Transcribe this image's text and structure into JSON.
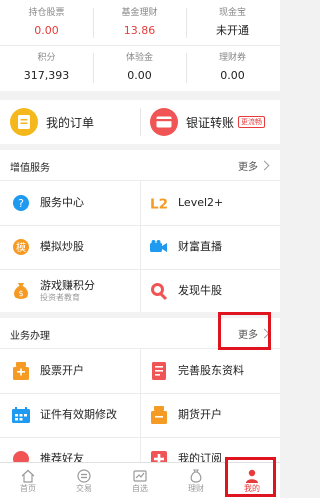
{
  "account": {
    "row1": [
      {
        "label": "持仓股票",
        "value": "0.00",
        "value_color": "#e73b3b"
      },
      {
        "label": "基金理财",
        "value": "13.86",
        "value_color": "#e73b3b"
      },
      {
        "label": "现金宝",
        "value": "未开通",
        "value_color": "#222222"
      }
    ],
    "row2": [
      {
        "label": "积分",
        "value": "317,393"
      },
      {
        "label": "体验金",
        "value": "0.00"
      },
      {
        "label": "理财券",
        "value": "0.00"
      }
    ]
  },
  "quick_actions": {
    "orders_label": "我的订单",
    "transfer_label": "银证转账",
    "transfer_badge": "更流畅"
  },
  "value_services": {
    "title": "增值服务",
    "more_label": "更多",
    "items": [
      {
        "label": "服务中心",
        "icon": "question-icon"
      },
      {
        "label": "Level2+",
        "icon": "l2-icon"
      },
      {
        "label": "模拟炒股",
        "icon": "simulate-icon"
      },
      {
        "label": "财富直播",
        "icon": "live-camera-icon"
      },
      {
        "label": "游戏赚积分",
        "sublabel": "投资者教育",
        "icon": "money-bag-icon"
      },
      {
        "label": "发现牛股",
        "icon": "magnifier-icon"
      }
    ]
  },
  "business": {
    "title": "业务办理",
    "more_label": "更多",
    "items": [
      {
        "label": "股票开户",
        "icon": "open-account-icon"
      },
      {
        "label": "完善股东资料",
        "icon": "document-icon"
      },
      {
        "label": "证件有效期修改",
        "icon": "calendar-icon"
      },
      {
        "label": "期货开户",
        "icon": "futures-icon"
      },
      {
        "label": "推荐好友",
        "icon": "recommend-icon"
      },
      {
        "label": "我的订阅",
        "icon": "subscription-icon"
      }
    ]
  },
  "tabbar": {
    "tabs": [
      {
        "label": "首页",
        "icon": "home-icon"
      },
      {
        "label": "交易",
        "icon": "trade-icon"
      },
      {
        "label": "自选",
        "icon": "watchlist-icon"
      },
      {
        "label": "理财",
        "icon": "wealth-icon"
      },
      {
        "label": "我的",
        "icon": "profile-icon",
        "active": true
      }
    ]
  },
  "colors": {
    "accent_red": "#e73b3b",
    "highlight_red": "#e0141e",
    "order_yellow": "#f5b81c",
    "transfer_red": "#f05454",
    "icon_blue": "#1e9bf0",
    "icon_orange": "#f59a23"
  }
}
